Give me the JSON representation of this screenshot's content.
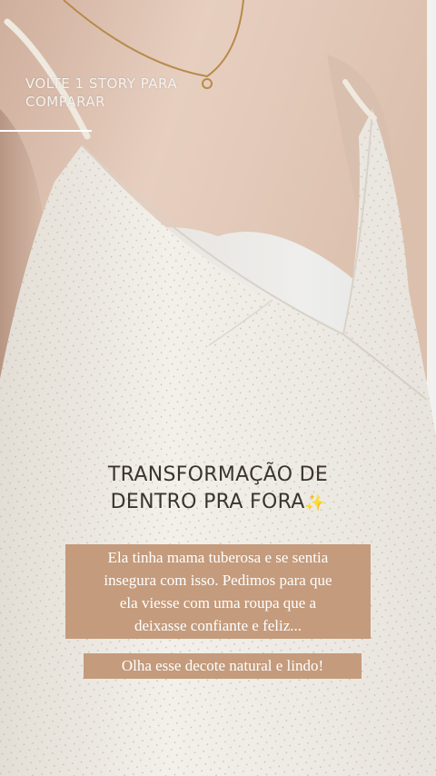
{
  "story": {
    "top_caption_lines": [
      "VOLTE 1 STORY PARA",
      "COMPARAR"
    ],
    "headline_lines": [
      "TRANSFORMAÇÃO DE",
      "DENTRO PRA FORA"
    ],
    "headline_emoji": "✨",
    "body_lines": [
      "Ela tinha mama tuberosa e se sentia",
      "insegura com isso. Pedimos para que",
      "ela viesse com uma roupa que a",
      "deixasse confiante e feliz..."
    ],
    "highlight_text": "Olha esse decote natural e lindo!"
  },
  "colors": {
    "caption_box": "#c49b7c",
    "headline_text": "#3b3430",
    "overlay_text": "#ffffff"
  }
}
